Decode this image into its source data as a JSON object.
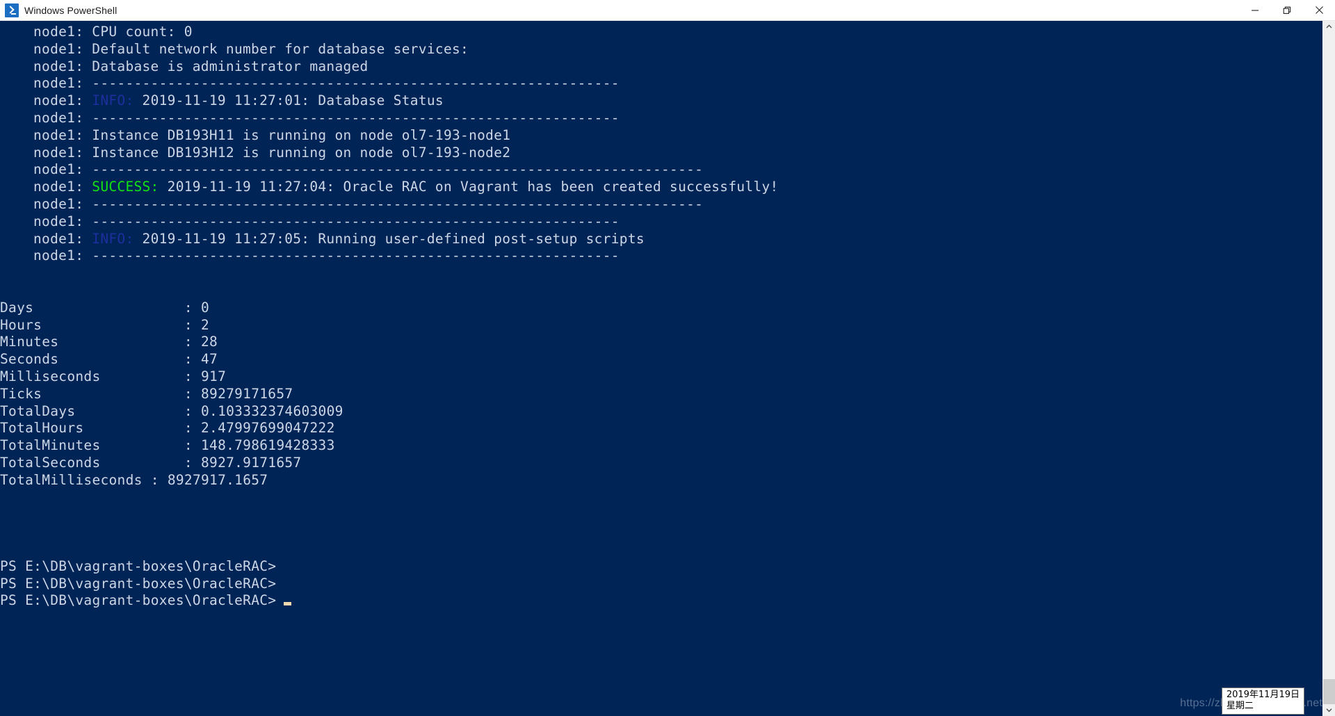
{
  "window": {
    "title": "Windows PowerShell",
    "app_icon": "powershell-prompt-icon",
    "background_color": "#012456",
    "foreground_color": "#ccd6e6",
    "controls": {
      "minimize_label": "Minimize",
      "restore_label": "Restore Down",
      "close_label": "Close"
    }
  },
  "terminal": {
    "prefix": "node1: ",
    "lines": [
      {
        "id": "l01",
        "text": "node1: CPU count: 0",
        "indent": true
      },
      {
        "id": "l02",
        "text": "node1: Default network number for database services:",
        "indent": true
      },
      {
        "id": "l03",
        "text": "node1: Database is administrator managed",
        "indent": true
      },
      {
        "id": "l04",
        "text": "node1: ---------------------------------------------------------------",
        "indent": true
      },
      {
        "id": "l05",
        "text": "node1: ",
        "indent": true,
        "tag": "INFO:",
        "tag_color": "#1d2f9e",
        "rest": " 2019-11-19 11:27:01: Database Status"
      },
      {
        "id": "l06",
        "text": "node1: ---------------------------------------------------------------",
        "indent": true
      },
      {
        "id": "l07",
        "text": "node1: Instance DB193H11 is running on node ol7-193-node1",
        "indent": true
      },
      {
        "id": "l08",
        "text": "node1: Instance DB193H12 is running on node ol7-193-node2",
        "indent": true
      },
      {
        "id": "l09",
        "text": "node1: -------------------------------------------------------------------------",
        "indent": true
      },
      {
        "id": "l10",
        "text": "node1: ",
        "indent": true,
        "tag": "SUCCESS:",
        "tag_color": "#12e312",
        "rest": " 2019-11-19 11:27:04: Oracle RAC on Vagrant has been created successfully!"
      },
      {
        "id": "l11",
        "text": "node1: -------------------------------------------------------------------------",
        "indent": true
      },
      {
        "id": "l12",
        "text": "node1: ---------------------------------------------------------------",
        "indent": true
      },
      {
        "id": "l13",
        "text": "node1: ",
        "indent": true,
        "tag": "INFO:",
        "tag_color": "#1d2f9e",
        "rest": " 2019-11-19 11:27:05: Running user-defined post-setup scripts"
      },
      {
        "id": "l14",
        "text": "node1: ---------------------------------------------------------------",
        "indent": true
      },
      {
        "id": "l15",
        "text": "",
        "indent": true
      },
      {
        "id": "l16",
        "text": "",
        "indent": true
      },
      {
        "id": "l17",
        "text": "",
        "indent": true
      }
    ],
    "timespan": {
      "rows": [
        {
          "name": "Days",
          "value": "0"
        },
        {
          "name": "Hours",
          "value": "2"
        },
        {
          "name": "Minutes",
          "value": "28"
        },
        {
          "name": "Seconds",
          "value": "47"
        },
        {
          "name": "Milliseconds",
          "value": "917"
        },
        {
          "name": "Ticks",
          "value": "89279171657"
        },
        {
          "name": "TotalDays",
          "value": "0.103332374603009"
        },
        {
          "name": "TotalHours",
          "value": "2.47997699047222"
        },
        {
          "name": "TotalMinutes",
          "value": "148.798619428333"
        },
        {
          "name": "TotalSeconds",
          "value": "8927.9171657"
        },
        {
          "name": "TotalMilliseconds",
          "value": "8927917.1657"
        }
      ],
      "separator": ":"
    },
    "prompts": [
      {
        "id": "p1",
        "text": "PS E:\\DB\\vagrant-boxes\\OracleRAC>",
        "cursor": false
      },
      {
        "id": "p2",
        "text": "PS E:\\DB\\vagrant-boxes\\OracleRAC>",
        "cursor": false
      },
      {
        "id": "p3",
        "text": "PS E:\\DB\\vagrant-boxes\\OracleRAC>",
        "cursor": true
      }
    ]
  },
  "scrollbar": {
    "up_arrow": "chevron-up-icon",
    "down_arrow": "chevron-down-icon",
    "thumb_position": "bottom"
  },
  "date_tooltip": {
    "line1": "2019年11月19日",
    "line2": "星期二"
  },
  "watermark": {
    "text": "https://zhaoyu.blog.csdn.net"
  }
}
